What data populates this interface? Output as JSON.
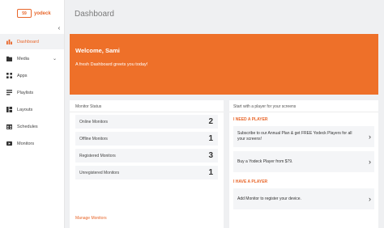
{
  "sidebar": {
    "logo_mark": "59",
    "logo_text": "yodeck",
    "collapse_icon": "‹",
    "items": [
      {
        "label": "Dashboard",
        "icon": "dashboard-icon",
        "active": true
      },
      {
        "label": "Media",
        "icon": "folder-icon",
        "has_children": true
      },
      {
        "label": "Apps",
        "icon": "apps-grid-icon"
      },
      {
        "label": "Playlists",
        "icon": "playlist-icon"
      },
      {
        "label": "Layouts",
        "icon": "layout-icon"
      },
      {
        "label": "Schedules",
        "icon": "schedule-icon"
      },
      {
        "label": "Monitors",
        "icon": "monitor-icon"
      }
    ],
    "caret": "⌄"
  },
  "header": {
    "title": "Dashboard"
  },
  "welcome": {
    "title": "Welcome, Sami",
    "subtitle": "A fresh Dashboard greets you today!",
    "background": "#ee7029"
  },
  "monitor_status": {
    "heading": "Monitor Status",
    "rows": [
      {
        "label": "Online Monitors",
        "count": "2"
      },
      {
        "label": "Offline Monitors",
        "count": "1"
      },
      {
        "label": "Registered Monitors",
        "count": "3"
      },
      {
        "label": "Unregistered Monitors",
        "count": "1"
      }
    ],
    "manage_link": "Manage Monitors"
  },
  "start_player": {
    "heading": "Start with a player for your screens",
    "need_label": "I NEED A PLAYER",
    "have_label": "I HAVE A PLAYER",
    "offers": [
      {
        "text": "Subscribe to our Annual Plan & get FREE Yodeck Players for all your screens!"
      },
      {
        "text": "Buy a Yodeck Player from $79."
      },
      {
        "text": "Add Monitor to register your device."
      }
    ],
    "arrow": "›"
  },
  "colors": {
    "accent": "#e8662a",
    "banner": "#ee7029",
    "background": "#eff0f2"
  }
}
